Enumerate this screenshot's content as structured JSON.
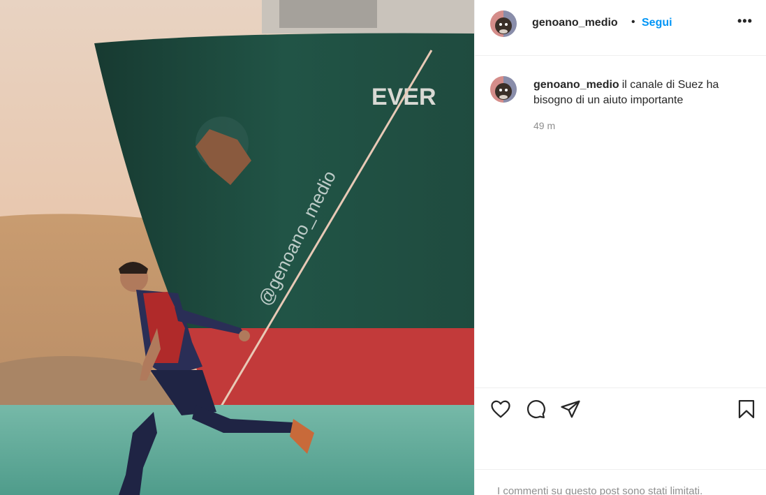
{
  "post": {
    "watermark": "@genoano_medio",
    "ship_lettering": "EVER"
  },
  "header": {
    "username": "genoano_medio",
    "separator": "•",
    "follow_label": "Segui",
    "more_label": "•••",
    "avatar_icon": "avatar-icon"
  },
  "comment": {
    "username": "genoano_medio",
    "text": "il canale di Suez ha bisogno di un aiuto importante",
    "time": "49 m"
  },
  "actions": {
    "icons": [
      "heart-icon",
      "comment-icon",
      "share-icon",
      "bookmark-icon"
    ]
  },
  "footer": {
    "limited_text": "I commenti su questo post sono stati limitati."
  },
  "colors": {
    "follow": "#0095f6",
    "text": "#262626",
    "muted": "#8e8e8e",
    "border": "#efefef"
  }
}
